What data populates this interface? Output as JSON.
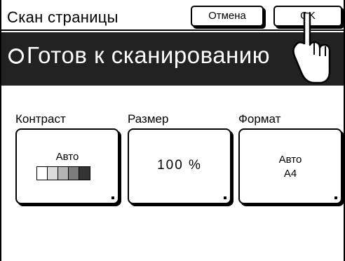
{
  "header": {
    "title": "Скан страницы",
    "cancel_label": "Отмена",
    "ok_label": "OK"
  },
  "banner": {
    "status": "Готов к сканированию"
  },
  "settings": [
    {
      "label": "Контраст",
      "value": "Авто"
    },
    {
      "label": "Размер",
      "value": "100 %"
    },
    {
      "label": "Формат",
      "value": "Авто",
      "value2": "A4"
    }
  ],
  "contrast_scale": [
    "#ffffff",
    "#dcdcdc",
    "#b4b4b4",
    "#7c7c7c",
    "#333333"
  ],
  "icons": [
    "status-ring-icon",
    "pointing-hand-icon",
    "corner-arrow-icon"
  ]
}
